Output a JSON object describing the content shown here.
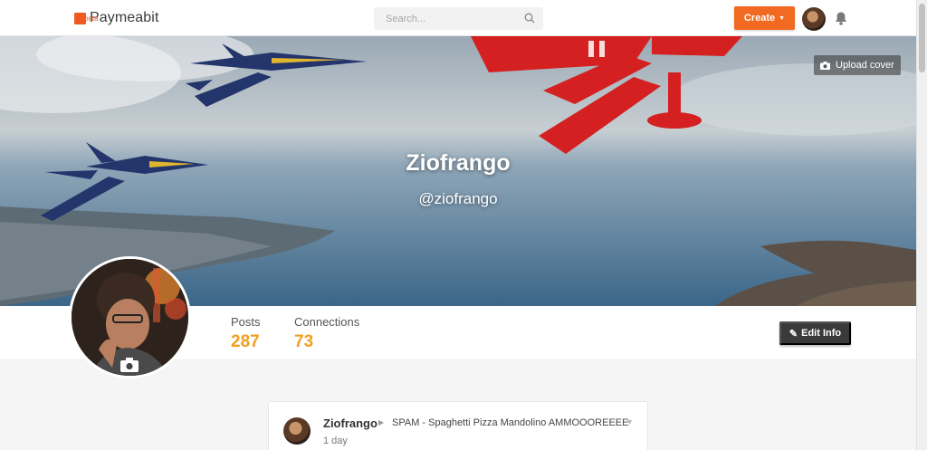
{
  "brand": {
    "name": "Paymeabit",
    "tag": "beta",
    "accent": "#f05a22"
  },
  "search": {
    "placeholder": "Search...",
    "icon": "search-icon"
  },
  "header": {
    "create_label": "Create",
    "create_caret": "▼",
    "notifications_icon": "bell-icon",
    "avatar": "user-avatar"
  },
  "cover": {
    "upload_label": "Upload cover",
    "upload_icon": "camera-icon"
  },
  "profile": {
    "name": "Ziofrango",
    "handle": "@ziofrango"
  },
  "stats": [
    {
      "label": "Posts",
      "value": "287"
    },
    {
      "label": "Connections",
      "value": "73"
    }
  ],
  "edit_info": {
    "label": "Edit Info",
    "icon": "pencil-icon"
  },
  "post": {
    "author": "Ziofrango",
    "arrow": "▶",
    "channel": "SPAM - Spaghetti Pizza Mandolino AMMOOOREEEE",
    "caret": "▼",
    "time": "1 day"
  },
  "colors": {
    "create": "#f26a21",
    "stat_value": "#f0a020",
    "edit_button": "#3a3a3a"
  }
}
